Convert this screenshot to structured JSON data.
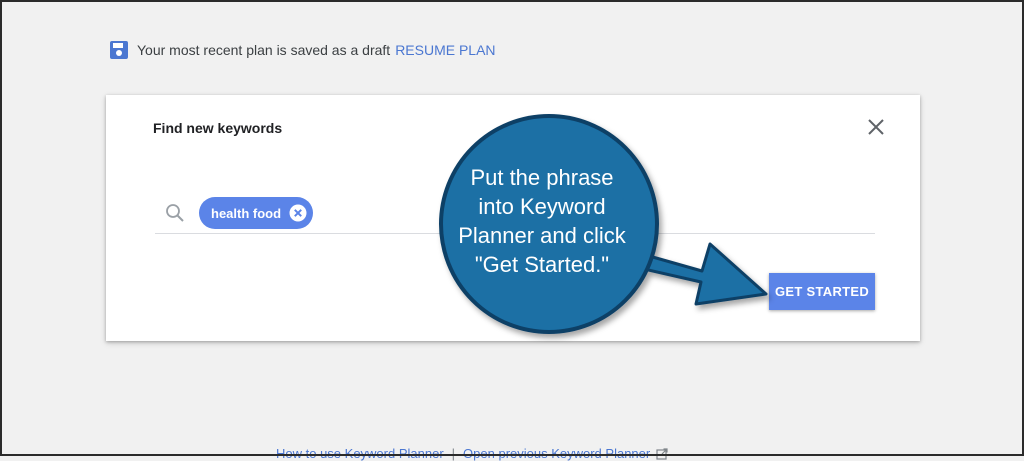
{
  "draft_banner": {
    "icon": "floppy-save-icon",
    "text": "Your most recent plan is saved as a draft",
    "resume_label": "RESUME PLAN"
  },
  "card": {
    "title": "Find new keywords",
    "search": {
      "icon": "search-icon",
      "chips": [
        {
          "label": "health food"
        }
      ]
    },
    "get_started_label": "GET STARTED",
    "close_icon": "close-icon"
  },
  "callout": {
    "lines": [
      "Put the phrase",
      "into Keyword",
      "Planner and click",
      "\"Get Started.\""
    ]
  },
  "footer": {
    "how_to_label": "How to use Keyword Planner",
    "separator": "|",
    "previous_label": "Open previous Keyword Planner"
  },
  "colors": {
    "page_bg": "#f1f1f1",
    "accent_blue": "#5b84e8",
    "link_blue": "#4b77d1",
    "callout_blue": "#1a6fa5",
    "callout_outline": "#0e3f66"
  }
}
